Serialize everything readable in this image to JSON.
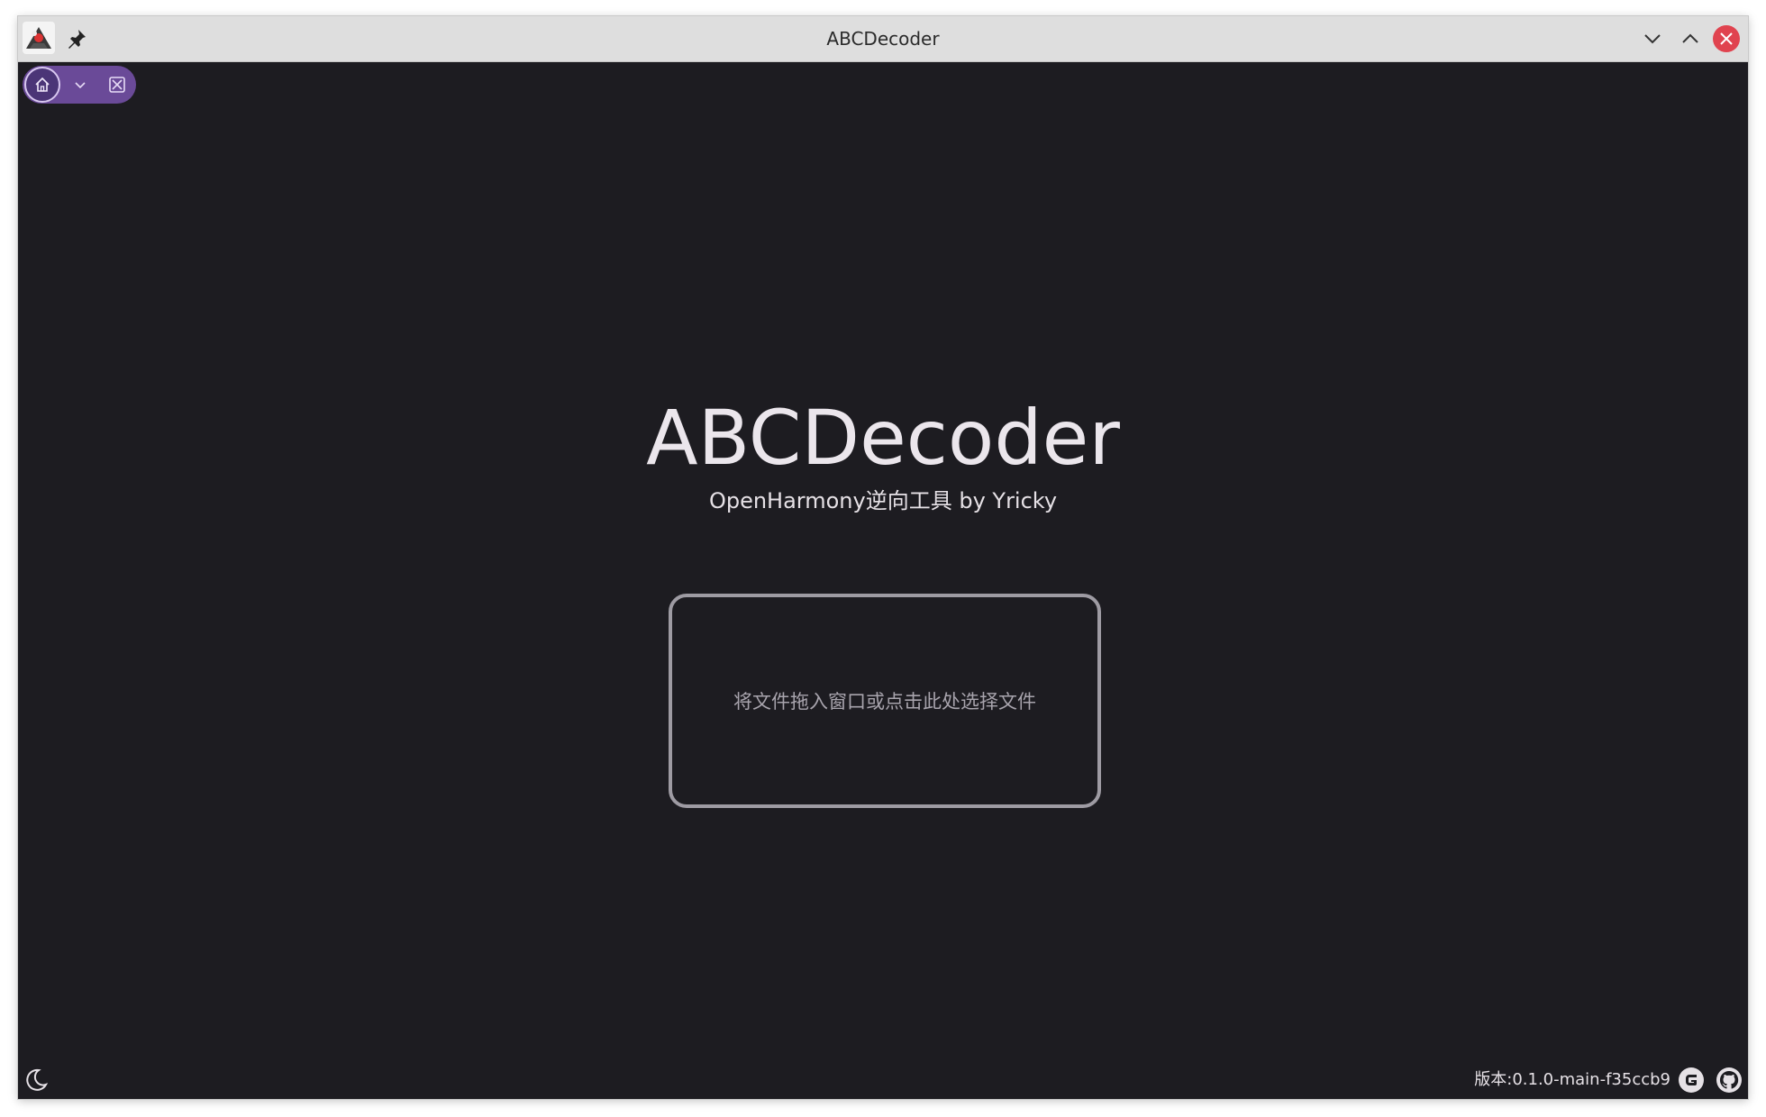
{
  "window": {
    "title": "ABCDecoder",
    "buttons": [
      "minimize",
      "maximize",
      "close"
    ]
  },
  "toolbar": {
    "home_icon": "home-icon",
    "dropdown_icon": "chevron-down-icon",
    "close_tab_icon": "close-box-icon",
    "accent_color": "#6a4a98"
  },
  "main": {
    "title": "ABCDecoder",
    "subtitle": "OpenHarmony逆向工具 by Yricky",
    "drop_zone_text": "将文件拖入窗口或点击此处选择文件"
  },
  "footer": {
    "theme_icon": "moon-icon",
    "version": "版本:0.1.0-main-f35ccb9",
    "links": [
      "gitee-icon",
      "github-icon"
    ]
  },
  "colors": {
    "background": "#1d1c21",
    "titlebar": "#dedede",
    "close_button": "#e0434f",
    "text_primary": "#ebe6ec",
    "text_muted": "#a8a4ad"
  }
}
